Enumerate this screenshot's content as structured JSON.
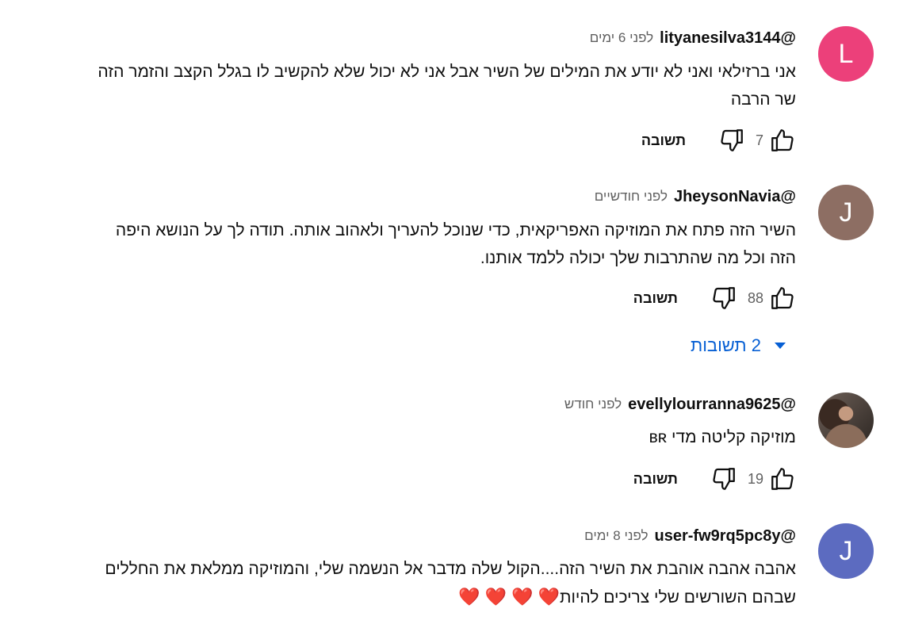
{
  "comments": [
    {
      "author": "@lityanesilva3144",
      "time": "לפני 6 ימים",
      "avatar_letter": "L",
      "avatar_color": "#ec407a",
      "lines": [
        "אני ברזילאי ואני לא יודע את המילים של השיר אבל אני לא יכול שלא להקשיב לו בגלל הקצב והזמר הזה",
        "שר הרבה"
      ],
      "likes": "7",
      "reply_label": "תשובה"
    },
    {
      "author": "@JheysonNavia",
      "time": "לפני חודשיים",
      "avatar_letter": "J",
      "avatar_color": "#8d6e63",
      "lines": [
        "השיר הזה פתח את המוזיקה האפריקאית, כדי שנוכל להעריך ולאהוב אותה. תודה לך על הנושא היפה",
        "הזה וכל מה שהתרבות שלך יכולה ללמד אותנו."
      ],
      "likes": "88",
      "reply_label": "תשובה",
      "replies_label": "2 תשובות"
    },
    {
      "author": "@evellylourranna9625",
      "time": "לפני חודש",
      "avatar_letter": "",
      "lines": [
        "מוזיקה קליטה מדי ʙʀ"
      ],
      "likes": "19",
      "reply_label": "תשובה"
    },
    {
      "author": "@user-fw9rq5pc8y",
      "time": "לפני 8 ימים",
      "avatar_letter": "J",
      "avatar_color": "#5c6bc0",
      "lines": [
        "אהבה אהבה אוהבת את השיר הזה....הקול שלה מדבר אל הנשמה שלי, והמוזיקה ממלאת את החללים",
        "שבהם השורשים שלי צריכים להיות"
      ],
      "hearts": "❤️ ❤️ ❤️ ❤️"
    }
  ],
  "colors": {
    "link_blue": "#065fd4",
    "secondary_text": "#606060"
  },
  "icons": {
    "like": "thumb-up-icon",
    "dislike": "thumb-down-icon",
    "expand": "caret-down-icon"
  }
}
